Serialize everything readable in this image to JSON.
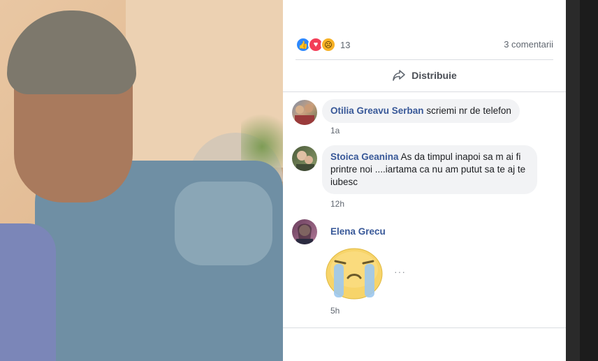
{
  "post": {
    "reaction_icons": [
      "like-icon",
      "love-icon",
      "sad-icon"
    ],
    "reaction_count": "13",
    "comments_count": "3 comentarii",
    "share_label": "Distribuie"
  },
  "comments": [
    {
      "author": "Otilia Greavu Serban",
      "text": "scriemi nr de telefon",
      "time": "1a"
    },
    {
      "author": "Stoica Geanina",
      "text": "As da timpul inapoi sa m ai fi printre noi ....iartama ca nu am putut sa te aj te iubesc",
      "time": "12h"
    },
    {
      "author": "Elena Grecu",
      "text": "",
      "time": "5h",
      "sticker": "crying-face-sticker"
    }
  ],
  "more_label": "···",
  "colors": {
    "link": "#385898",
    "like": "#2d88ff",
    "love": "#f33e58",
    "sad": "#f7b125",
    "bubble": "#f2f3f5"
  }
}
